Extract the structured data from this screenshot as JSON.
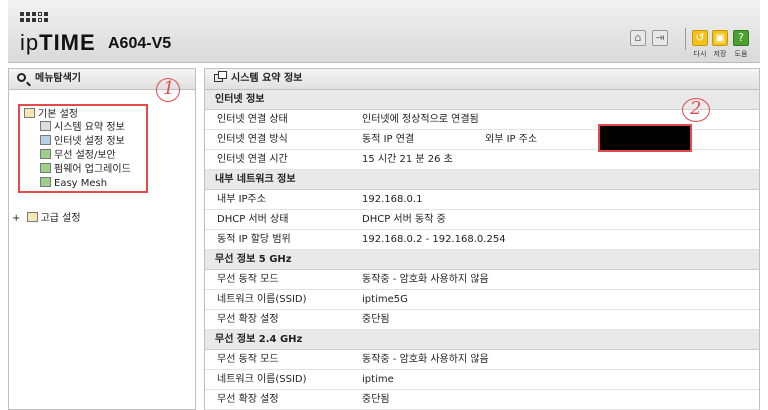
{
  "header": {
    "brand_prefix": "ip",
    "brand_bold": "TIME",
    "model": "A604-V5",
    "buttons": [
      {
        "icon": "home-icon"
      },
      {
        "icon": "logout-icon"
      },
      {
        "icon": "refresh-icon",
        "label": "다시"
      },
      {
        "icon": "save-icon",
        "label": "저장"
      },
      {
        "icon": "help-icon",
        "label": "도움"
      }
    ]
  },
  "left_panel": {
    "title": "메뉴탐색기",
    "basic": "기본 설정",
    "basic_items": [
      "시스템 요약 정보",
      "인터넷 설정 정보",
      "무선 설정/보안",
      "펌웨어 업그레이드",
      "Easy Mesh"
    ],
    "advanced": "고급 설정",
    "expander": "+"
  },
  "right_panel": {
    "title": "시스템 요약 정보",
    "internet": {
      "title": "인터넷 정보",
      "rows": [
        {
          "label": "인터넷 연결 상태",
          "value": "인터넷에 정상적으로 연결됨"
        },
        {
          "label": "인터넷 연결 방식",
          "value": "동적 IP 연결",
          "extra_label": "외부 IP 주소"
        },
        {
          "label": "인터넷 연결 시간",
          "value": "15 시간 21 분 26 초"
        }
      ]
    },
    "lan": {
      "title": "내부 네트워크 정보",
      "rows": [
        {
          "label": "내부 IP주소",
          "value": "192.168.0.1"
        },
        {
          "label": "DHCP 서버 상태",
          "value": "DHCP 서버 동작 중"
        },
        {
          "label": "동적 IP 할당 범위",
          "value": "192.168.0.2 -  192.168.0.254"
        }
      ]
    },
    "wifi5": {
      "title": "무선 정보 5 GHz",
      "rows": [
        {
          "label": "무선 동작 모드",
          "value": "동작중 - 암호화 사용하지 않음"
        },
        {
          "label": "네트워크 이름(SSID)",
          "value": "iptime5G"
        },
        {
          "label": "무선 확장 설정",
          "value": "중단됨"
        }
      ]
    },
    "wifi24": {
      "title": "무선 정보 2.4 GHz",
      "rows": [
        {
          "label": "무선 동작 모드",
          "value": "동작중 - 암호화 사용하지 않음"
        },
        {
          "label": "네트워크 이름(SSID)",
          "value": "iptime"
        },
        {
          "label": "무선 확장 설정",
          "value": "중단됨"
        }
      ]
    }
  },
  "annotations": {
    "one": "1",
    "two": "2"
  }
}
